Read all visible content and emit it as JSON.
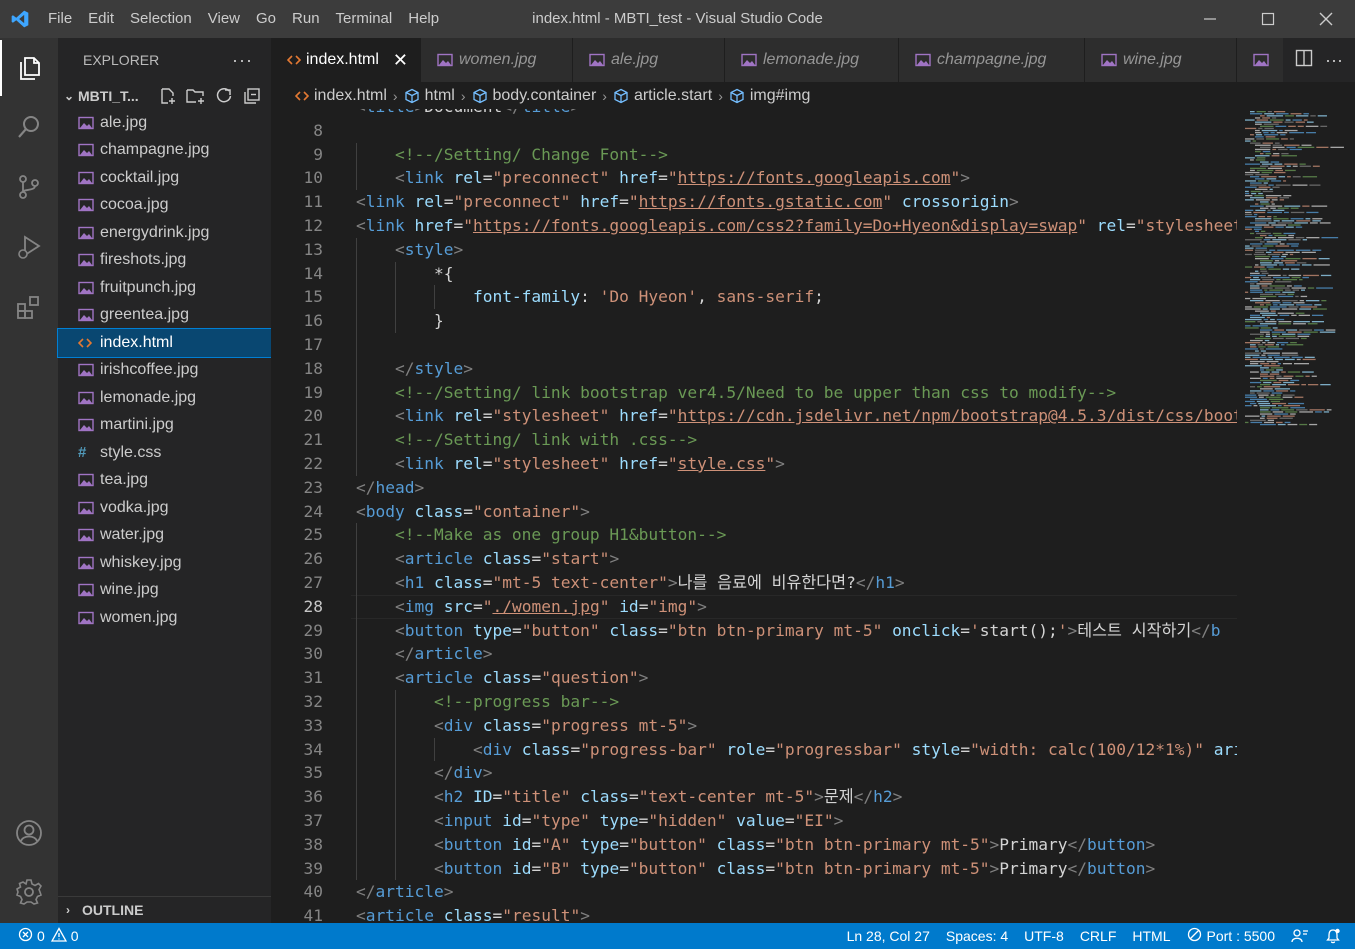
{
  "window": {
    "title": "index.html - MBTI_test - Visual Studio Code"
  },
  "menu": [
    "File",
    "Edit",
    "Selection",
    "View",
    "Go",
    "Run",
    "Terminal",
    "Help"
  ],
  "explorer": {
    "header": "EXPLORER",
    "folder": "MBTI_T...",
    "files": [
      {
        "name": "ale.jpg",
        "type": "image"
      },
      {
        "name": "champagne.jpg",
        "type": "image"
      },
      {
        "name": "cocktail.jpg",
        "type": "image"
      },
      {
        "name": "cocoa.jpg",
        "type": "image"
      },
      {
        "name": "energydrink.jpg",
        "type": "image"
      },
      {
        "name": "fireshots.jpg",
        "type": "image"
      },
      {
        "name": "fruitpunch.jpg",
        "type": "image"
      },
      {
        "name": "greentea.jpg",
        "type": "image"
      },
      {
        "name": "index.html",
        "type": "html",
        "active": true
      },
      {
        "name": "irishcoffee.jpg",
        "type": "image"
      },
      {
        "name": "lemonade.jpg",
        "type": "image"
      },
      {
        "name": "martini.jpg",
        "type": "image"
      },
      {
        "name": "style.css",
        "type": "css"
      },
      {
        "name": "tea.jpg",
        "type": "image"
      },
      {
        "name": "vodka.jpg",
        "type": "image"
      },
      {
        "name": "water.jpg",
        "type": "image"
      },
      {
        "name": "whiskey.jpg",
        "type": "image"
      },
      {
        "name": "wine.jpg",
        "type": "image"
      },
      {
        "name": "women.jpg",
        "type": "image"
      }
    ],
    "outline": "OUTLINE"
  },
  "tabs": [
    {
      "label": "index.html",
      "type": "html",
      "active": true
    },
    {
      "label": "women.jpg",
      "type": "image"
    },
    {
      "label": "ale.jpg",
      "type": "image"
    },
    {
      "label": "lemonade.jpg",
      "type": "image"
    },
    {
      "label": "champagne.jpg",
      "type": "image"
    },
    {
      "label": "wine.jpg",
      "type": "image"
    }
  ],
  "breadcrumb": [
    "index.html",
    "html",
    "body.container",
    "article.start",
    "img#img"
  ],
  "editor": {
    "current_line": 28,
    "first_line_partial": "<title>Document</title>"
  },
  "status": {
    "errors": "0",
    "warnings": "0",
    "position": "Ln 28, Col 27",
    "spaces": "Spaces: 4",
    "encoding": "UTF-8",
    "eol": "CRLF",
    "language": "HTML",
    "port": "Port : 5500"
  },
  "colors": {
    "statusbar": "#007acc",
    "activity": "#333333",
    "sidebar": "#252526",
    "editor": "#1e1e1e",
    "tag": "#569cd6",
    "attr": "#9cdcfe",
    "string": "#ce9178",
    "comment": "#6a9955"
  }
}
